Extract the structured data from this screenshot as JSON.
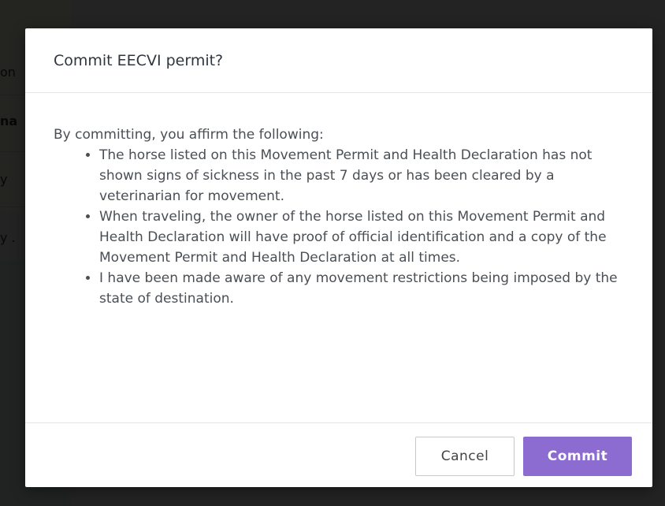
{
  "background": {
    "fragments": [
      "on",
      "na",
      "y",
      "y ."
    ]
  },
  "modal": {
    "title": "Commit EECVI permit?",
    "intro": "By committing, you affirm the following:",
    "items": [
      "The horse listed on this Movement Permit and Health Declaration has not shown signs of sickness in the past 7 days or has been cleared by a veterinarian for movement.",
      "When traveling, the owner of the horse listed on this Movement Permit and Health Declaration will have proof of official identification and a copy of the Movement Permit and Health Declaration at all times.",
      "I have been made aware of any movement restrictions being imposed by the state of destination."
    ],
    "cancel_label": "Cancel",
    "commit_label": "Commit"
  },
  "colors": {
    "accent": "#8c6cd0",
    "overlay": "#000000"
  }
}
